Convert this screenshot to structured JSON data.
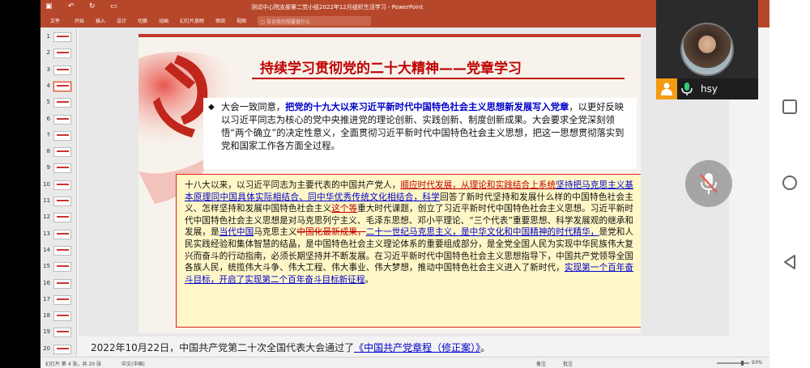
{
  "app": {
    "window_title": "测试中心院支部第二党小组2022年12月组织生活学习 - PowerPoint",
    "ribbon_tabs": [
      "文件",
      "开始",
      "插入",
      "设计",
      "切换",
      "动画",
      "幻灯片放映",
      "审阅",
      "视图"
    ],
    "search_placeholder": "告诉我你想要做什么",
    "quick_access": [
      "保存",
      "撤销",
      "重做",
      "演示"
    ]
  },
  "thumbnails": [
    "1",
    "2",
    "3",
    "4",
    "5",
    "6",
    "7",
    "8",
    "9",
    "10",
    "11",
    "12",
    "13",
    "14",
    "15",
    "16",
    "17",
    "18",
    "19",
    "20"
  ],
  "selected_slide": "4",
  "slide": {
    "title": "持续学习贯彻党的二十大精神——党章学习",
    "p1_bullet": "◆",
    "p1_part1": "大会一致同意，",
    "p1_highlight": "把党的十九大以来习近平新时代中国特色社会主义思想新发展写入党章",
    "p1_part2": "，以更好反映以习近平同志为核心的党中央推进党的理论创新、实践创新、制度创新成果。大会要求全党深刻领悟“两个确立”的决定性意义，全面贯彻习近平新时代中国特色社会主义思想，把这一思想贯彻落实到党和国家工作各方面全过程。",
    "p2_a": "十八大以来，以习近平同志为主要代表的中国共产党人，",
    "p2_b": "顺应时代发展，从理论和实践结合上系统",
    "p2_c": "坚持把马克思主义基本原理同中国具体实际相结合、同中华优秀传统文化相结合，科学",
    "p2_d": "回答了新时代坚持和发展什么样的中国特色社会主义、怎样坚持和发展中国特色社会主义",
    "p2_e": "这个等",
    "p2_f": "重大时代课题，创立了习近平新时代中国特色社会主义思想。习近平新时代中国特色社会主义思想是对马克思列宁主义、毛泽东思想、邓小平理论、“三个代表”重要思想、科学发展观的继承和发展，是",
    "p2_g": "当代中国",
    "p2_h": "马克思主义",
    "p2_i": "中国化最新成果，",
    "p2_j": "二十一世纪马克思主义，是中华文化和中国精神的时代精华，",
    "p2_k": "是党和人民实践经验和集体智慧的结晶，是中国特色社会主义理论体系的重要组成部分，是全党全国人民为实现中华民族伟大复兴而奋斗的行动指南，必须长期坚持并不断发展。在习近平新时代中国特色社会主义思想指导下，中国共产党领导全国各族人民，统揽伟大斗争、伟大工程、伟大事业、伟大梦想，推动中国特色社会主义进入了新时代，",
    "p2_l": "实现第一个百年奋斗目标，开启了实现第二个百年奋斗目标新征程",
    "p2_m": "。"
  },
  "caption": {
    "prefix": "2022年10月22日，中国共产党第二十次全国代表大会通过了",
    "link": "《中国共产党章程（修正案）》",
    "suffix": "。"
  },
  "statusbar": {
    "slide_info": "幻灯片 第 4 张，共 20 张",
    "language": "中文(中国)",
    "notes": "备注",
    "comments": "批注",
    "zoom": "93%"
  },
  "video": {
    "user": "hsy"
  },
  "colors": {
    "accent": "#b7472a",
    "title_red": "#c00000",
    "highlight_blue": "#0000cc"
  }
}
